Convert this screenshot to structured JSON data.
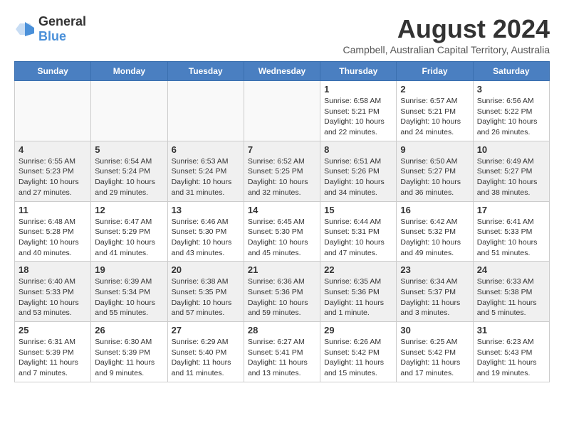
{
  "logo": {
    "general": "General",
    "blue": "Blue"
  },
  "title": "August 2024",
  "subtitle": "Campbell, Australian Capital Territory, Australia",
  "headers": [
    "Sunday",
    "Monday",
    "Tuesday",
    "Wednesday",
    "Thursday",
    "Friday",
    "Saturday"
  ],
  "weeks": [
    [
      {
        "day": "",
        "info": ""
      },
      {
        "day": "",
        "info": ""
      },
      {
        "day": "",
        "info": ""
      },
      {
        "day": "",
        "info": ""
      },
      {
        "day": "1",
        "info": "Sunrise: 6:58 AM\nSunset: 5:21 PM\nDaylight: 10 hours\nand 22 minutes."
      },
      {
        "day": "2",
        "info": "Sunrise: 6:57 AM\nSunset: 5:21 PM\nDaylight: 10 hours\nand 24 minutes."
      },
      {
        "day": "3",
        "info": "Sunrise: 6:56 AM\nSunset: 5:22 PM\nDaylight: 10 hours\nand 26 minutes."
      }
    ],
    [
      {
        "day": "4",
        "info": "Sunrise: 6:55 AM\nSunset: 5:23 PM\nDaylight: 10 hours\nand 27 minutes."
      },
      {
        "day": "5",
        "info": "Sunrise: 6:54 AM\nSunset: 5:24 PM\nDaylight: 10 hours\nand 29 minutes."
      },
      {
        "day": "6",
        "info": "Sunrise: 6:53 AM\nSunset: 5:24 PM\nDaylight: 10 hours\nand 31 minutes."
      },
      {
        "day": "7",
        "info": "Sunrise: 6:52 AM\nSunset: 5:25 PM\nDaylight: 10 hours\nand 32 minutes."
      },
      {
        "day": "8",
        "info": "Sunrise: 6:51 AM\nSunset: 5:26 PM\nDaylight: 10 hours\nand 34 minutes."
      },
      {
        "day": "9",
        "info": "Sunrise: 6:50 AM\nSunset: 5:27 PM\nDaylight: 10 hours\nand 36 minutes."
      },
      {
        "day": "10",
        "info": "Sunrise: 6:49 AM\nSunset: 5:27 PM\nDaylight: 10 hours\nand 38 minutes."
      }
    ],
    [
      {
        "day": "11",
        "info": "Sunrise: 6:48 AM\nSunset: 5:28 PM\nDaylight: 10 hours\nand 40 minutes."
      },
      {
        "day": "12",
        "info": "Sunrise: 6:47 AM\nSunset: 5:29 PM\nDaylight: 10 hours\nand 41 minutes."
      },
      {
        "day": "13",
        "info": "Sunrise: 6:46 AM\nSunset: 5:30 PM\nDaylight: 10 hours\nand 43 minutes."
      },
      {
        "day": "14",
        "info": "Sunrise: 6:45 AM\nSunset: 5:30 PM\nDaylight: 10 hours\nand 45 minutes."
      },
      {
        "day": "15",
        "info": "Sunrise: 6:44 AM\nSunset: 5:31 PM\nDaylight: 10 hours\nand 47 minutes."
      },
      {
        "day": "16",
        "info": "Sunrise: 6:42 AM\nSunset: 5:32 PM\nDaylight: 10 hours\nand 49 minutes."
      },
      {
        "day": "17",
        "info": "Sunrise: 6:41 AM\nSunset: 5:33 PM\nDaylight: 10 hours\nand 51 minutes."
      }
    ],
    [
      {
        "day": "18",
        "info": "Sunrise: 6:40 AM\nSunset: 5:33 PM\nDaylight: 10 hours\nand 53 minutes."
      },
      {
        "day": "19",
        "info": "Sunrise: 6:39 AM\nSunset: 5:34 PM\nDaylight: 10 hours\nand 55 minutes."
      },
      {
        "day": "20",
        "info": "Sunrise: 6:38 AM\nSunset: 5:35 PM\nDaylight: 10 hours\nand 57 minutes."
      },
      {
        "day": "21",
        "info": "Sunrise: 6:36 AM\nSunset: 5:36 PM\nDaylight: 10 hours\nand 59 minutes."
      },
      {
        "day": "22",
        "info": "Sunrise: 6:35 AM\nSunset: 5:36 PM\nDaylight: 11 hours\nand 1 minute."
      },
      {
        "day": "23",
        "info": "Sunrise: 6:34 AM\nSunset: 5:37 PM\nDaylight: 11 hours\nand 3 minutes."
      },
      {
        "day": "24",
        "info": "Sunrise: 6:33 AM\nSunset: 5:38 PM\nDaylight: 11 hours\nand 5 minutes."
      }
    ],
    [
      {
        "day": "25",
        "info": "Sunrise: 6:31 AM\nSunset: 5:39 PM\nDaylight: 11 hours\nand 7 minutes."
      },
      {
        "day": "26",
        "info": "Sunrise: 6:30 AM\nSunset: 5:39 PM\nDaylight: 11 hours\nand 9 minutes."
      },
      {
        "day": "27",
        "info": "Sunrise: 6:29 AM\nSunset: 5:40 PM\nDaylight: 11 hours\nand 11 minutes."
      },
      {
        "day": "28",
        "info": "Sunrise: 6:27 AM\nSunset: 5:41 PM\nDaylight: 11 hours\nand 13 minutes."
      },
      {
        "day": "29",
        "info": "Sunrise: 6:26 AM\nSunset: 5:42 PM\nDaylight: 11 hours\nand 15 minutes."
      },
      {
        "day": "30",
        "info": "Sunrise: 6:25 AM\nSunset: 5:42 PM\nDaylight: 11 hours\nand 17 minutes."
      },
      {
        "day": "31",
        "info": "Sunrise: 6:23 AM\nSunset: 5:43 PM\nDaylight: 11 hours\nand 19 minutes."
      }
    ]
  ]
}
